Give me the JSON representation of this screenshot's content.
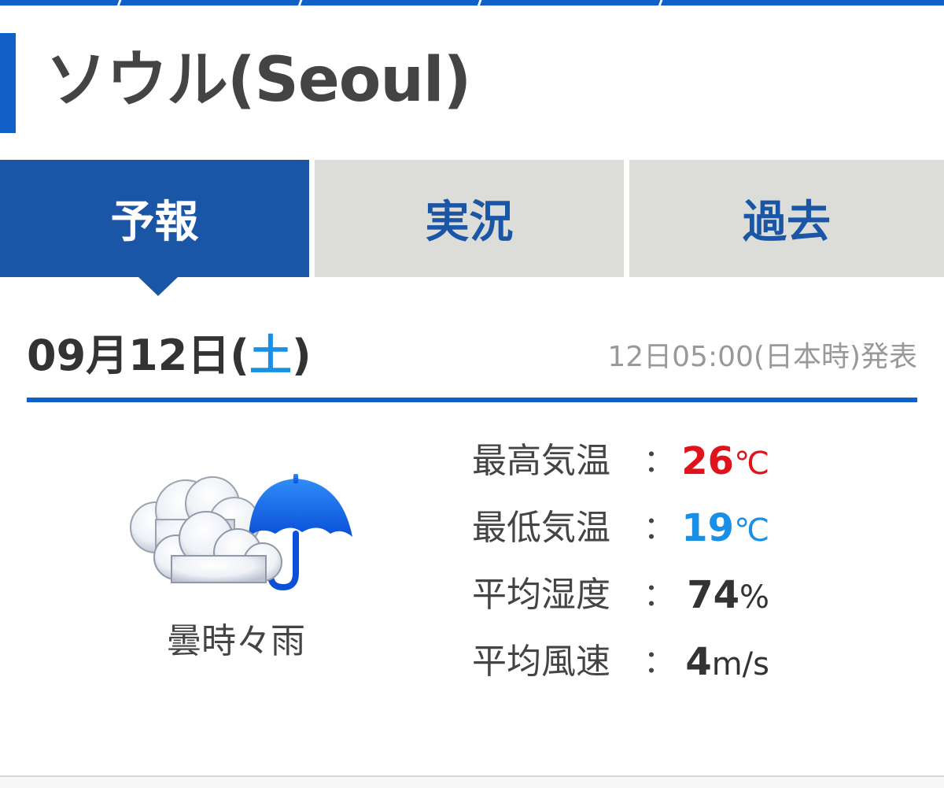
{
  "header": {
    "title": "ソウル(Seoul)"
  },
  "tabs": [
    {
      "label": "予報",
      "active": true
    },
    {
      "label": "実況",
      "active": false
    },
    {
      "label": "過去",
      "active": false
    }
  ],
  "forecast": {
    "date_prefix": "09月12日(",
    "day_of_week": "土",
    "date_suffix": ")",
    "issued": "12日05:00(日本時)発表",
    "condition": "曇時々雨",
    "icon": "cloud-rain-umbrella-icon",
    "stats": [
      {
        "label": "最高気温",
        "colon": "：",
        "value": "26",
        "unit": "℃",
        "color": "#e0121b"
      },
      {
        "label": "最低気温",
        "colon": "：",
        "value": "19",
        "unit": "℃",
        "color": "#1a8fe6"
      },
      {
        "label": "平均湿度",
        "colon": "：",
        "value": "74",
        "unit": "%",
        "color": "#333333"
      },
      {
        "label": "平均風速",
        "colon": "：",
        "value": "4",
        "unit": "m/s",
        "color": "#333333"
      }
    ]
  },
  "colors": {
    "accent": "#1060c8",
    "tab_active": "#1a55a6",
    "tab_inactive": "#dcdcd9"
  }
}
